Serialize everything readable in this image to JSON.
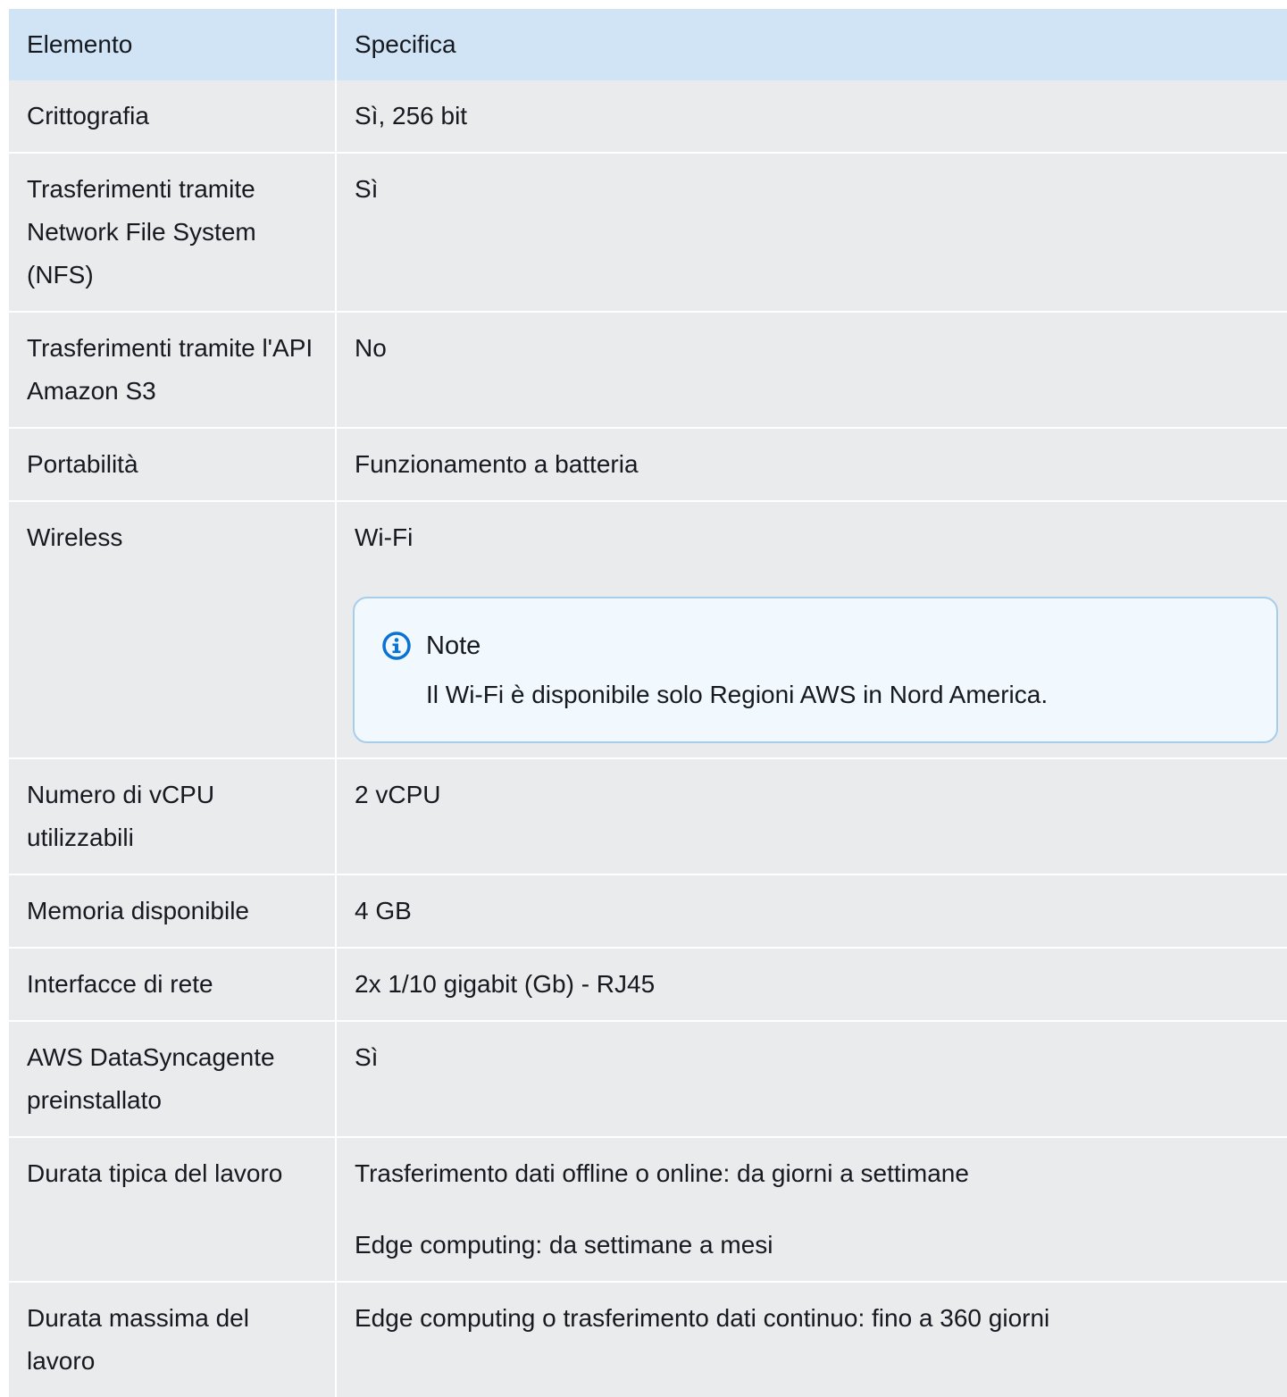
{
  "table": {
    "headers": [
      "Elemento",
      "Specifica"
    ],
    "rows": [
      {
        "element": "Crittografia",
        "spec": [
          "Sì, 256 bit"
        ]
      },
      {
        "element": "Trasferimenti tramite Network File System (NFS)",
        "spec": [
          "Sì"
        ]
      },
      {
        "element": "Trasferimenti tramite l'API Amazon S3",
        "spec": [
          "No"
        ]
      },
      {
        "element": "Portabilità",
        "spec": [
          "Funzionamento a batteria"
        ]
      },
      {
        "element": "Wireless",
        "spec": [
          "Wi-Fi"
        ],
        "note": {
          "title": "Note",
          "text": "Il Wi-Fi è disponibile solo Regioni AWS in Nord America."
        }
      },
      {
        "element": "Numero di vCPU utilizzabili",
        "spec": [
          "2 vCPU"
        ]
      },
      {
        "element": "Memoria disponibile",
        "spec": [
          "4 GB"
        ]
      },
      {
        "element": "Interfacce di rete",
        "spec": [
          "2x 1/10 gigabit (Gb) - RJ45"
        ]
      },
      {
        "element": "AWS DataSyncagente preinstallato",
        "spec": [
          "Sì"
        ]
      },
      {
        "element": "Durata tipica del lavoro",
        "spec": [
          "Trasferimento dati offline o online: da giorni a settimane",
          "Edge computing: da settimane a mesi"
        ]
      },
      {
        "element": "Durata massima del lavoro",
        "spec": [
          "Edge computing o trasferimento dati continuo: fino a 360 giorni"
        ]
      }
    ]
  },
  "colors": {
    "header_bg": "#d1e4f6",
    "row_bg": "#eaebed",
    "note_border": "#a8cdeb",
    "note_bg": "#f1f8fe",
    "info_icon": "#0972d3"
  },
  "icons": {
    "note": "info-icon"
  }
}
